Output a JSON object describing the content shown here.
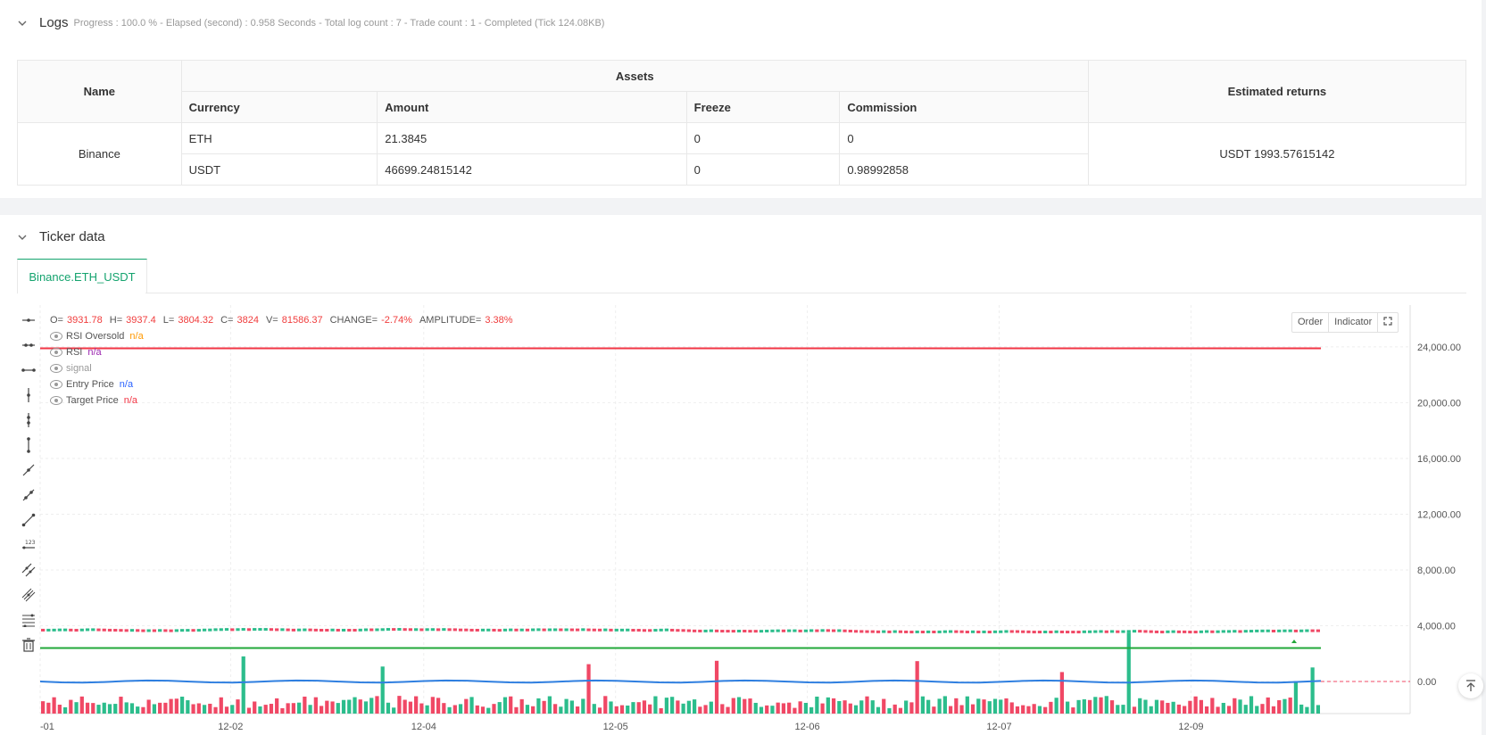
{
  "logs": {
    "title": "Logs",
    "status": "Progress : 100.0 % - Elapsed (second) : 0.958  Seconds - Total log count : 7 - Trade count : 1 - Completed (Tick 124.08KB)"
  },
  "assets_table": {
    "headers": {
      "name": "Name",
      "assets": "Assets",
      "estimated": "Estimated returns",
      "currency": "Currency",
      "amount": "Amount",
      "freeze": "Freeze",
      "commission": "Commission"
    },
    "exchange": "Binance",
    "rows": [
      {
        "currency": "ETH",
        "amount": "21.3845",
        "freeze": "0",
        "commission": "0"
      },
      {
        "currency": "USDT",
        "amount": "46699.24815142",
        "freeze": "0",
        "commission": "0.98992858"
      }
    ],
    "estimated_returns": "USDT 1993.57615142"
  },
  "ticker": {
    "title": "Ticker data",
    "tab": "Binance.ETH_USDT"
  },
  "chart": {
    "ohlc": {
      "o_label": "O=",
      "o": "3931.78",
      "h_label": "H=",
      "h": "3937.4",
      "l_label": "L=",
      "l": "3804.32",
      "c_label": "C=",
      "c": "3824",
      "v_label": "V=",
      "v": "81586.37",
      "change_label": "CHANGE=",
      "change": "-2.74%",
      "amp_label": "AMPLITUDE=",
      "amp": "3.38%"
    },
    "legend": [
      {
        "name": "RSI Oversold",
        "value": "n/a",
        "color": "#ff9800"
      },
      {
        "name": "RSI",
        "value": "n/a",
        "color": "#9c27b0"
      },
      {
        "name": "signal",
        "value": "",
        "color": "#999999"
      },
      {
        "name": "Entry Price",
        "value": "n/a",
        "color": "#2962ff"
      },
      {
        "name": "Target Price",
        "value": "n/a",
        "color": "#f23645"
      }
    ],
    "buttons": {
      "order": "Order",
      "indicator": "Indicator"
    }
  },
  "chart_data": {
    "type": "candlestick",
    "y_ticks": [
      "24,000.00",
      "20,000.00",
      "16,000.00",
      "12,000.00",
      "8,000.00",
      "4,000.00",
      "0.00"
    ],
    "y_tick_values": [
      24000,
      20000,
      16000,
      12000,
      8000,
      4000,
      0
    ],
    "ylim": [
      -2300,
      27000
    ],
    "x_ticks": [
      "-01",
      "12-02",
      "12-04",
      "12-05",
      "12-06",
      "12-07",
      "12-09"
    ],
    "x_tick_positions": [
      0.0,
      0.139,
      0.28,
      0.42,
      0.56,
      0.7,
      0.84
    ],
    "target_price_line": 23900,
    "rsi_oversold_line": 2400,
    "rsi_line": 0,
    "price_range": [
      3550,
      4050
    ],
    "colors": {
      "up": "#2cbd8c",
      "down": "#f04865",
      "target": "#f23645",
      "oversold": "#22a83a",
      "rsi": "#2f7fe0"
    }
  }
}
